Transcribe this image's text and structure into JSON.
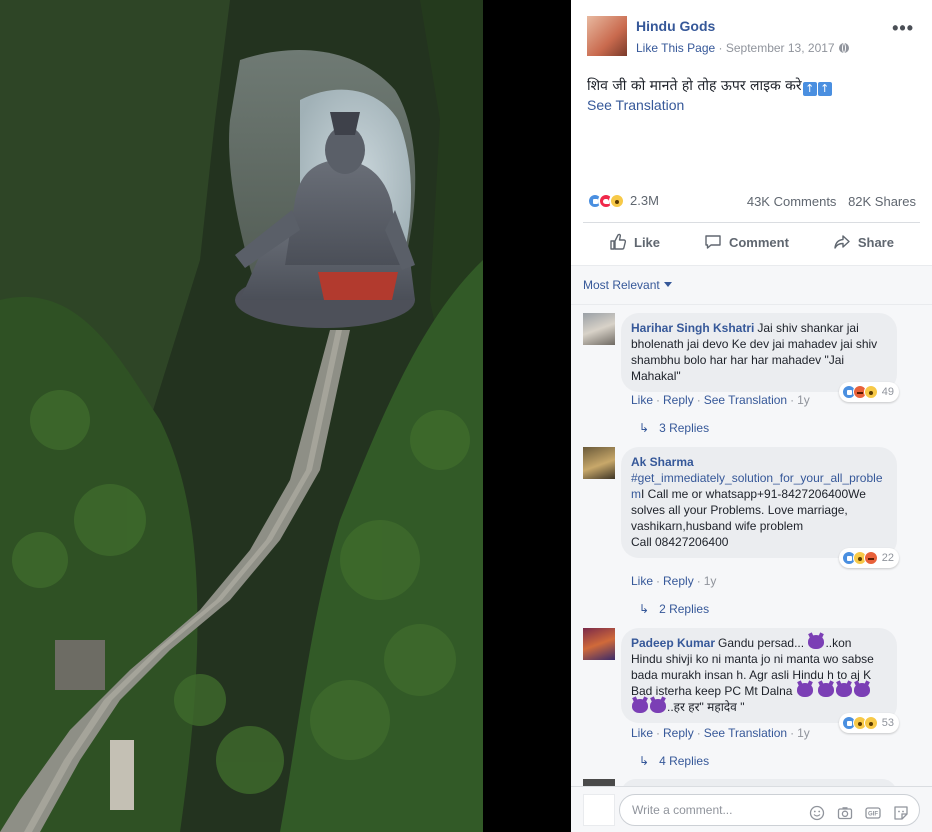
{
  "post": {
    "page_name": "Hindu Gods",
    "like_page": "Like This Page",
    "separator": " · ",
    "date": "September 13, 2017",
    "text": "शिव जी को मानते हो तोह ऊपर लाइक करे",
    "see_translation": "See Translation",
    "reaction_count": "2.3M",
    "comments_count": "43K Comments",
    "shares_count": "82K Shares"
  },
  "actions": {
    "like": "Like",
    "comment": "Comment",
    "share": "Share"
  },
  "sort": {
    "label": "Most Relevant"
  },
  "comments": [
    {
      "author": "Harihar Singh Kshatri",
      "text": "Jai shiv shankar jai bholenath jai devo Ke dev jai mahadev jai shiv shambhu bolo har har har mahadev \"Jai Mahakal\"",
      "reaction_count": "49",
      "like": "Like",
      "reply": "Reply",
      "see_translation": "See Translation",
      "time": "1y",
      "replies": "3 Replies"
    },
    {
      "author": "Ak Sharma",
      "hashtag": "#get_immediately_solution_for_your_all_problem",
      "text": "I Call me or whatsapp+91-8427206400We solves all your Problems. Love marriage, vashikarn,husband wife problem",
      "text2": "Call 08427206400",
      "reaction_count": "22",
      "like": "Like",
      "reply": "Reply",
      "time": "1y",
      "replies": "2 Replies"
    },
    {
      "author": "Padeep Kumar",
      "text_a": "Gandu persad...",
      "text_b": "..kon Hindu shivji ko ni manta jo ni manta wo sabse bada murakh insan h. Agr asli Hindu h to aj K Bad isterha keep PC Mt Dalna",
      "text_c": "..हर हर\" महादेव \"",
      "reaction_count": "53",
      "like": "Like",
      "reply": "Reply",
      "see_translation": "See Translation",
      "time": "1y",
      "replies": "4 Replies"
    }
  ],
  "write_comment": {
    "placeholder": "Write a comment..."
  },
  "icons": {
    "more": "more-options-icon",
    "globe": "globe-icon",
    "like": "thumbs-up-icon",
    "comment": "speech-bubble-icon",
    "share": "share-arrow-icon",
    "emoji": "smiley-icon",
    "camera": "camera-icon",
    "gif": "gif-icon",
    "sticker": "sticker-icon"
  },
  "colors": {
    "link": "#365899",
    "like_blue": "#4a8fe0",
    "love_red": "#f0284a",
    "wow_yellow": "#f7c948"
  }
}
